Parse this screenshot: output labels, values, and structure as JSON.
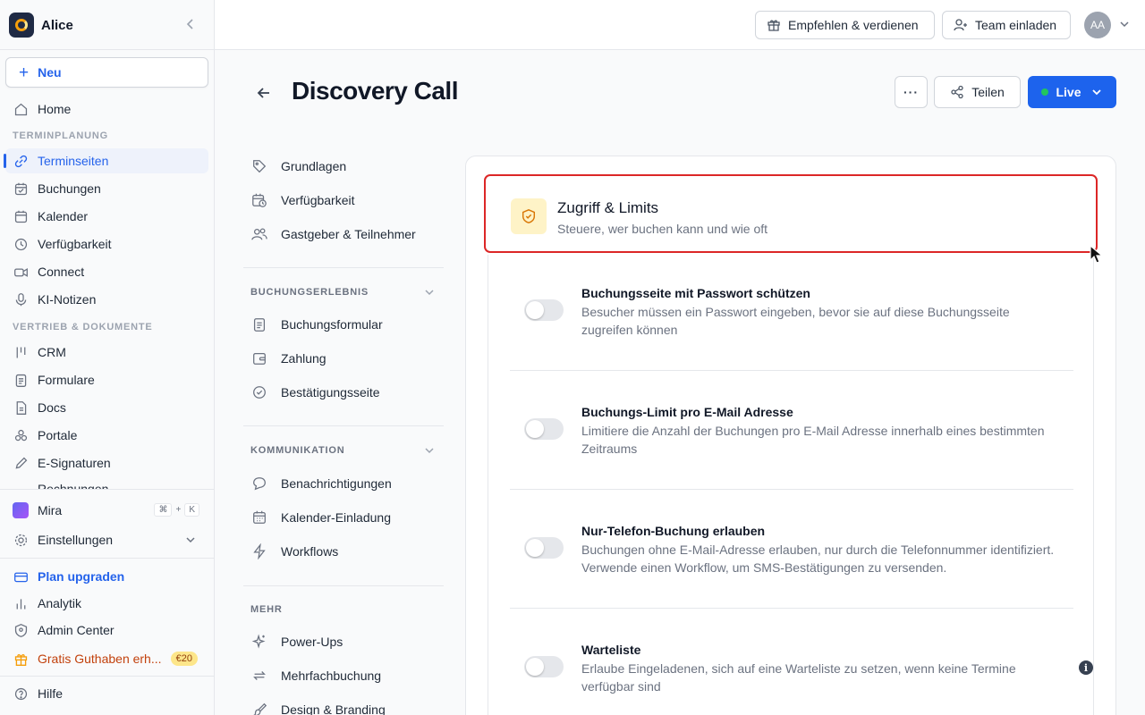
{
  "workspace": {
    "name": "Alice"
  },
  "sidebar": {
    "new_label": "Neu",
    "home": "Home",
    "section_scheduling": "TERMINPLANUNG",
    "scheduling": [
      "Terminseiten",
      "Buchungen",
      "Kalender",
      "Verfügbarkeit",
      "Connect",
      "KI-Notizen"
    ],
    "section_sales": "VERTRIEB & DOKUMENTE",
    "sales": [
      "CRM",
      "Formulare",
      "Docs",
      "Portale",
      "E-Signaturen",
      "Rechnungen"
    ],
    "mira": "Mira",
    "shortcut": [
      "⌘",
      "+",
      "K"
    ],
    "settings": "Einstellungen",
    "upgrade": "Plan upgraden",
    "analytics": "Analytik",
    "admin": "Admin Center",
    "credit": "Gratis Guthaben erh...",
    "credit_badge": "€20",
    "help": "Hilfe"
  },
  "topbar": {
    "refer": "Empfehlen & verdienen",
    "invite": "Team einladen",
    "avatar": "AA"
  },
  "header": {
    "title": "Discovery Call",
    "more": "···",
    "share": "Teilen",
    "live": "Live",
    "live_color": "#22c55e"
  },
  "settings_nav": {
    "basics": [
      "Grundlagen",
      "Verfügbarkeit",
      "Gastgeber & Teilnehmer"
    ],
    "section_booking": "BUCHUNGSERLEBNIS",
    "booking": [
      "Buchungsformular",
      "Zahlung",
      "Bestätigungsseite"
    ],
    "section_comm": "KOMMUNIKATION",
    "comm": [
      "Benachrichtigungen",
      "Kalender-Einladung",
      "Workflows"
    ],
    "section_more": "MEHR",
    "more": [
      "Power-Ups",
      "Mehrfachbuchung",
      "Design & Branding"
    ]
  },
  "section": {
    "title": "Zugriff & Limits",
    "subtitle": "Steuere, wer buchen kann und wie oft",
    "highlight_color": "#dc2626"
  },
  "rows": [
    {
      "title": "Buchungsseite mit Passwort schützen",
      "desc": "Besucher müssen ein Passwort eingeben, bevor sie auf diese Buchungsseite zugreifen können",
      "enabled": false
    },
    {
      "title": "Buchungs-Limit pro E-Mail Adresse",
      "desc": "Limitiere die Anzahl der Buchungen pro E-Mail Adresse innerhalb eines bestimmten Zeitraums",
      "enabled": false
    },
    {
      "title": "Nur-Telefon-Buchung erlauben",
      "desc": "Buchungen ohne E-Mail-Adresse erlauben, nur durch die Telefonnummer identifiziert. Verwende einen Workflow, um SMS-Bestätigungen zu versenden.",
      "enabled": false
    },
    {
      "title": "Warteliste",
      "desc": "Erlaube Eingeladenen, sich auf eine Warteliste zu setzen, wenn keine Termine verfügbar sind",
      "enabled": false
    }
  ],
  "info_glyph": "i"
}
